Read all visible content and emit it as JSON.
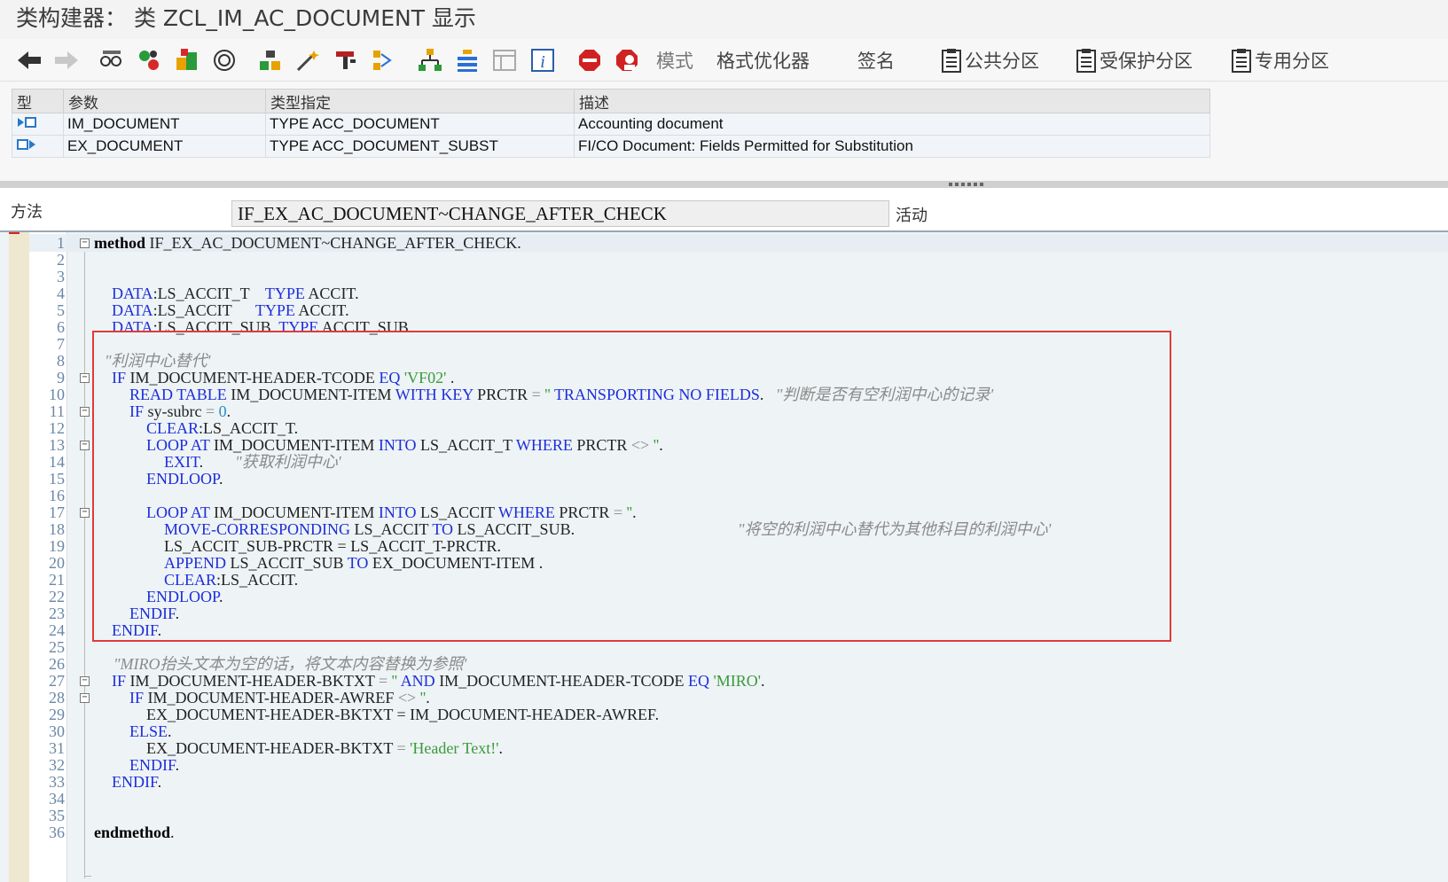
{
  "window": {
    "title": "类构建器：  类 ZCL_IM_AC_DOCUMENT 显示"
  },
  "toolbar": {
    "mode_label": "模式",
    "pretty_printer_label": "格式优化器",
    "signature_label": "签名",
    "public_section_label": "公共分区",
    "protected_section_label": "受保护分区",
    "private_section_label": "专用分区"
  },
  "params": {
    "headers": [
      "型",
      "参数",
      "类型指定",
      "描述"
    ],
    "rows": [
      {
        "name": "IM_DOCUMENT",
        "type": "TYPE ACC_DOCUMENT",
        "desc": "Accounting document"
      },
      {
        "name": "EX_DOCUMENT",
        "type": "TYPE ACC_DOCUMENT_SUBST",
        "desc": "FI/CO Document: Fields Permitted for Substitution"
      }
    ]
  },
  "method": {
    "label": "方法",
    "value": "IF_EX_AC_DOCUMENT~CHANGE_AFTER_CHECK",
    "status": "活动"
  },
  "editor": {
    "line_numbers": [
      "1",
      "2",
      "3",
      "4",
      "5",
      "6",
      "7",
      "8",
      "9",
      "10",
      "11",
      "12",
      "13",
      "14",
      "15",
      "16",
      "17",
      "18",
      "19",
      "20",
      "21",
      "22",
      "23",
      "24",
      "25",
      "26",
      "27",
      "28",
      "29",
      "30",
      "31",
      "32",
      "33",
      "34",
      "35",
      "36"
    ],
    "kw": {
      "method": "method",
      "endmethod": "endmethod",
      "data": "DATA",
      "type": "TYPE",
      "if": "IF",
      "eq": "EQ",
      "read_table": "READ TABLE",
      "with_key": "WITH KEY",
      "transporting": "TRANSPORTING NO FIELDS",
      "clear": "CLEAR",
      "loop_at": "LOOP AT",
      "into": "INTO",
      "where": "WHERE",
      "exit": "EXIT",
      "endloop": "ENDLOOP",
      "move_corr": "MOVE-CORRESPONDING",
      "to": "TO",
      "append": "APPEND",
      "endif": "ENDIF",
      "and": "AND",
      "else": "ELSE"
    },
    "text": {
      "method_name": " IF_EX_AC_DOCUMENT~CHANGE_AFTER_CHECK.",
      "ls_accit_t": ":LS_ACCIT_T    ",
      "ls_accit": ":LS_ACCIT      ",
      "ls_accit_sub": ":LS_ACCIT_SUB  ",
      "accit": " ACCIT.",
      "accit_sub": " ACCIT_SUB.",
      "im_hdr_tcode": " IM_DOCUMENT-HEADER-TCODE ",
      "im_item": " IM_DOCUMENT-ITEM ",
      "prctr": " PRCTR ",
      "sy_subrc": " sy-subrc ",
      "clear_t": ":LS_ACCIT_T.",
      "into_t": " LS_ACCIT_T ",
      "into_a": " LS_ACCIT ",
      "move_src": " LS_ACCIT ",
      "move_dst": " LS_ACCIT_SUB.",
      "assign_prctr": "LS_ACCIT_SUB-PRCTR = LS_ACCIT_T-PRCTR.",
      "append_src": " LS_ACCIT_SUB ",
      "append_dst": " EX_DOCUMENT-ITEM .",
      "clear_a": ":LS_ACCIT.",
      "im_hdr_bktxt": " IM_DOCUMENT-HEADER-BKTXT ",
      "im_hdr_awref": " IM_DOCUMENT-HEADER-AWREF ",
      "ex_bktxt_awref": "EX_DOCUMENT-HEADER-BKTXT = IM_DOCUMENT-HEADER-AWREF.",
      "ex_bktxt": "EX_DOCUMENT-HEADER-BKTXT ",
      "period": ".",
      "space_period": " .",
      "dot_after": "."
    },
    "ops": {
      "eq": "=",
      "ne": "<>"
    },
    "strings": {
      "vf02": "'VF02'",
      "empty": "''",
      "miro": "'MIRO'",
      "header_text": "'Header Text!'"
    },
    "nums": {
      "zero": "0"
    },
    "comments": {
      "c8": "\"利润中心替代'",
      "c10": "\"判断是否有空利润中心的记录'",
      "c14": "\"获取利润中心'",
      "c18": "\"将空的利润中心替代为其他科目的利润中心'",
      "c26": "\"MIRO抬头文本为空的话，将文本内容替换为参照'"
    }
  }
}
